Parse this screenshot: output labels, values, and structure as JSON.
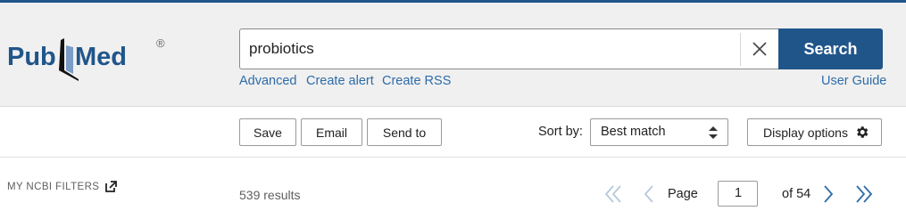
{
  "brand": {
    "logo_part1": "Pub",
    "logo_part2": "Med",
    "registered": "®",
    "color": "#20558a"
  },
  "search": {
    "query": "probiotics",
    "button_label": "Search",
    "clear_icon": "close-icon"
  },
  "links": {
    "advanced": "Advanced",
    "create_alert": "Create alert",
    "create_rss": "Create RSS",
    "user_guide": "User Guide"
  },
  "toolbar": {
    "save_label": "Save",
    "email_label": "Email",
    "send_to_label": "Send to",
    "sort_label": "Sort by:",
    "sort_value": "Best match",
    "display_options_label": "Display options"
  },
  "sidebar": {
    "filters_label": "MY NCBI FILTERS",
    "filters_icon": "external-link-icon"
  },
  "results": {
    "count_text": "539 results"
  },
  "pagination": {
    "page_label": "Page",
    "current_page": "1",
    "of_label": "of 54"
  }
}
